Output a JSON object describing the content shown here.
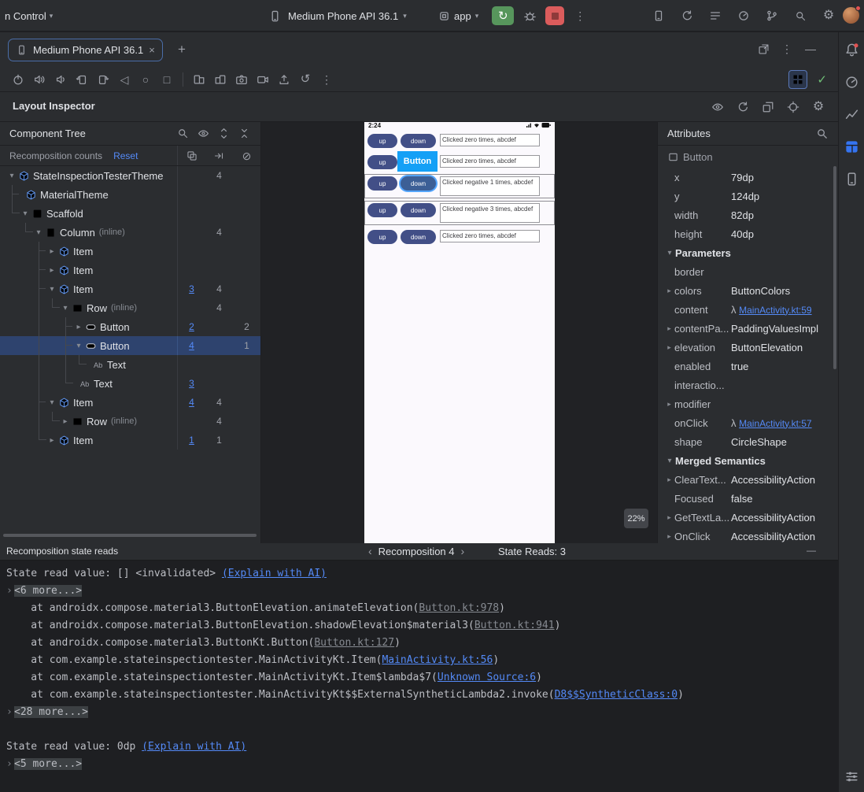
{
  "icons": {
    "close": "×",
    "add": "+",
    "minimize": "—",
    "more": "⋮",
    "back": "◁",
    "home": "○",
    "overview": "□",
    "undo": "↺",
    "gear": "⚙",
    "check": "✓",
    "chevron_down": "▾",
    "chevron_right": "▸",
    "prev": "‹",
    "next": "›",
    "lambda": "λ",
    "pause": "⊘",
    "rerun": "↻"
  },
  "topbar": {
    "vcs_label": "n Control",
    "device_selector": "Medium Phone API 36.1",
    "run_config": "app",
    "right_icons": [
      "device-manager",
      "sync",
      "todo-list",
      "profiler",
      "git-branch",
      "search",
      "settings"
    ]
  },
  "tabs": {
    "active_tab": "Medium Phone API 36.1",
    "actions": [
      "open-in-window",
      "more",
      "minimize"
    ]
  },
  "device_toolbar": {
    "icons": [
      "power",
      "volume-up",
      "volume-down",
      "rotate-left",
      "rotate-right",
      "back",
      "home",
      "overview",
      "divider",
      "fold",
      "unfold",
      "camera",
      "screen-record",
      "upload",
      "undo",
      "more"
    ]
  },
  "inspector_title": "Layout Inspector",
  "inspector_icons": [
    "live-updates",
    "refresh",
    "snapshot",
    "pick-element",
    "inspector-settings"
  ],
  "component_tree": {
    "title": "Component Tree",
    "header_icons": [
      "search",
      "visibility",
      "expand-all",
      "collapse-all"
    ],
    "counts_label": "Recomposition counts",
    "reset_label": "Reset",
    "count_column_icons": [
      "recomposition-count",
      "skip-count",
      "pause-counts"
    ],
    "inline_label": "(inline)",
    "nodes": [
      {
        "depth": 0,
        "chevron": "v",
        "icon": "compose",
        "label": "StateInspectionTesterTheme",
        "c2": "4",
        "guides": []
      },
      {
        "depth": 1,
        "chevron": "",
        "icon": "compose",
        "label": "MaterialTheme",
        "guides": [
          {
            "s": 0,
            "t": "t"
          }
        ]
      },
      {
        "depth": 1,
        "chevron": "v",
        "icon": "scaffold",
        "label": "Scaffold",
        "guides": [
          {
            "s": 0,
            "t": "l"
          }
        ]
      },
      {
        "depth": 2,
        "chevron": "v",
        "icon": "column",
        "label": "Column",
        "inline": true,
        "c2": "4",
        "guides": [
          {
            "s": 1,
            "t": "l"
          }
        ]
      },
      {
        "depth": 3,
        "chevron": ">",
        "icon": "compose",
        "label": "Item",
        "guides": [
          {
            "s": 2,
            "t": "t"
          }
        ]
      },
      {
        "depth": 3,
        "chevron": ">",
        "icon": "compose",
        "label": "Item",
        "guides": [
          {
            "s": 2,
            "t": "t"
          }
        ]
      },
      {
        "depth": 3,
        "chevron": "v",
        "icon": "compose",
        "label": "Item",
        "c1": "3",
        "c2": "4",
        "guides": [
          {
            "s": 2,
            "t": "t"
          }
        ]
      },
      {
        "depth": 4,
        "chevron": "v",
        "icon": "row",
        "label": "Row",
        "inline": true,
        "c2": "4",
        "guides": [
          {
            "s": 2,
            "t": "v"
          },
          {
            "s": 3,
            "t": "l"
          }
        ]
      },
      {
        "depth": 5,
        "chevron": ">",
        "icon": "button",
        "label": "Button",
        "c1": "2",
        "c3": "2",
        "guides": [
          {
            "s": 2,
            "t": "v"
          },
          {
            "s": 4,
            "t": "t"
          }
        ]
      },
      {
        "depth": 5,
        "chevron": "v",
        "icon": "button",
        "label": "Button",
        "c1": "4",
        "c3": "1",
        "selected": true,
        "guides": [
          {
            "s": 2,
            "t": "v"
          },
          {
            "s": 4,
            "t": "t"
          }
        ]
      },
      {
        "depth": 6,
        "chevron": "",
        "icon": "text",
        "label": "Text",
        "guides": [
          {
            "s": 2,
            "t": "v"
          },
          {
            "s": 4,
            "t": "v"
          },
          {
            "s": 5,
            "t": "l"
          }
        ]
      },
      {
        "depth": 5,
        "chevron": "",
        "icon": "text",
        "label": "Text",
        "c1": "3",
        "guides": [
          {
            "s": 2,
            "t": "v"
          },
          {
            "s": 4,
            "t": "l"
          }
        ]
      },
      {
        "depth": 3,
        "chevron": "v",
        "icon": "compose",
        "label": "Item",
        "c1": "4",
        "c2": "4",
        "guides": [
          {
            "s": 2,
            "t": "t"
          }
        ]
      },
      {
        "depth": 4,
        "chevron": ">",
        "icon": "row",
        "label": "Row",
        "inline": true,
        "c2": "4",
        "guides": [
          {
            "s": 2,
            "t": "v"
          },
          {
            "s": 3,
            "t": "l"
          }
        ]
      },
      {
        "depth": 3,
        "chevron": ">",
        "icon": "compose",
        "label": "Item",
        "c1": "1",
        "c2": "1",
        "guides": [
          {
            "s": 2,
            "t": "l"
          }
        ]
      }
    ]
  },
  "device": {
    "status_time": "2:24",
    "zoom_label": "22%",
    "tooltip_label": "Button",
    "up_label": "up",
    "down_label": "down",
    "rows": [
      {
        "text": "Clicked zero times, abcdef",
        "two_line": false
      },
      {
        "text": "Clicked zero times, abcdef",
        "two_line": false,
        "tooltip": true
      },
      {
        "text": "Clicked negative 1 times, abcdef",
        "two_line": true,
        "selected": true,
        "row_border": true
      },
      {
        "text": "Clicked negative 3 times, abcdef",
        "two_line": true,
        "row_border": true
      },
      {
        "text": "Clicked zero times, abcdef",
        "two_line": false
      }
    ]
  },
  "attributes": {
    "title": "Attributes",
    "component": "Button",
    "rows": [
      {
        "label": "x",
        "value": "79dp"
      },
      {
        "label": "y",
        "value": "124dp"
      },
      {
        "label": "width",
        "value": "82dp"
      },
      {
        "label": "height",
        "value": "40dp"
      },
      {
        "section": "Parameters"
      },
      {
        "label": "border",
        "value": ""
      },
      {
        "label": "colors",
        "value": "ButtonColors",
        "exp": true
      },
      {
        "label": "content",
        "value": "MainActivity.kt:59",
        "lambda": true
      },
      {
        "label": "contentPa...",
        "value": "PaddingValuesImpl",
        "exp": true
      },
      {
        "label": "elevation",
        "value": "ButtonElevation",
        "exp": true
      },
      {
        "label": "enabled",
        "value": "true"
      },
      {
        "label": "interactio...",
        "value": ""
      },
      {
        "label": "modifier",
        "value": "",
        "exp": true
      },
      {
        "label": "onClick",
        "value": "MainActivity.kt:57",
        "lambda": true
      },
      {
        "label": "shape",
        "value": "CircleShape"
      },
      {
        "section": "Merged Semantics"
      },
      {
        "label": "ClearText...",
        "value": "AccessibilityAction",
        "exp": true
      },
      {
        "label": "Focused",
        "value": "false"
      },
      {
        "label": "GetTextLa...",
        "value": "AccessibilityAction",
        "exp": true
      },
      {
        "label": "OnClick",
        "value": "AccessibilityAction",
        "exp": true
      }
    ]
  },
  "console": {
    "title": "Recomposition state reads",
    "nav_label": "Recomposition 4",
    "state_reads_label": "State Reads: 3",
    "lines": [
      {
        "seg": [
          {
            "t": "State read value: [] "
          },
          {
            "t": "<invalidated>",
            "s": "tag"
          },
          {
            "t": " "
          },
          {
            "t": "(Explain with AI)",
            "s": "link"
          }
        ]
      },
      {
        "fold": "<6 more...>"
      },
      {
        "seg": [
          {
            "t": "    at androidx.compose.material3.ButtonElevation.animateElevation("
          },
          {
            "t": "Button.kt:978",
            "s": "dimlink"
          },
          {
            "t": ")"
          }
        ]
      },
      {
        "seg": [
          {
            "t": "    at androidx.compose.material3.ButtonElevation.shadowElevation$material3("
          },
          {
            "t": "Button.kt:941",
            "s": "dimlink"
          },
          {
            "t": ")"
          }
        ]
      },
      {
        "seg": [
          {
            "t": "    at androidx.compose.material3.ButtonKt.Button("
          },
          {
            "t": "Button.kt:127",
            "s": "dimlink"
          },
          {
            "t": ")"
          }
        ]
      },
      {
        "seg": [
          {
            "t": "    at com.example.stateinspectiontester.MainActivityKt.Item("
          },
          {
            "t": "MainActivity.kt:56",
            "s": "link"
          },
          {
            "t": ")"
          }
        ]
      },
      {
        "seg": [
          {
            "t": "    at com.example.stateinspectiontester.MainActivityKt.Item$lambda$7("
          },
          {
            "t": "Unknown Source:6",
            "s": "link"
          },
          {
            "t": ")"
          }
        ]
      },
      {
        "seg": [
          {
            "t": "    at com.example.stateinspectiontester.MainActivityKt$$ExternalSyntheticLambda2.invoke("
          },
          {
            "t": "D8$$SyntheticClass:0",
            "s": "link"
          },
          {
            "t": ")"
          }
        ]
      },
      {
        "fold": "<28 more...>"
      },
      {
        "seg": []
      },
      {
        "seg": [
          {
            "t": "State read value: 0dp "
          },
          {
            "t": "(Explain with AI)",
            "s": "link"
          }
        ]
      },
      {
        "fold": "<5 more...>"
      }
    ]
  },
  "right_strip": {
    "icons": [
      "notifications",
      "profiler-tool",
      "insights",
      "layout-inspector",
      "running-devices"
    ],
    "bottom_icon": "console-options"
  }
}
